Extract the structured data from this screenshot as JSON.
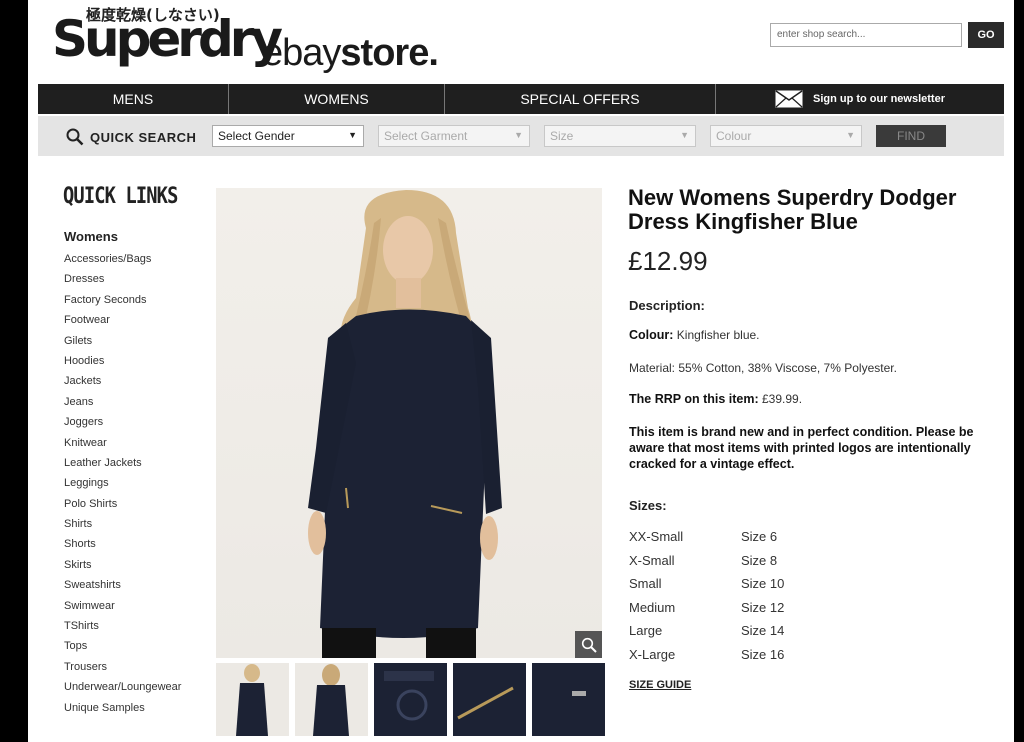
{
  "header": {
    "logo_jp": "極度乾燥(しなさい)",
    "logo_main": "Superdry",
    "logo_ebay_light": "ebay",
    "logo_ebay_bold": "store.",
    "search_placeholder": "enter shop search...",
    "go_label": "GO"
  },
  "nav": {
    "items": [
      "MENS",
      "WOMENS",
      "SPECIAL OFFERS"
    ],
    "newsletter": "Sign up to our newsletter"
  },
  "quick_search": {
    "label": "QUICK SEARCH",
    "gender": "Select Gender",
    "garment": "Select Garment",
    "size": "Size",
    "colour": "Colour",
    "find_label": "FIND"
  },
  "quick_links": {
    "title": "QUICK LINKS",
    "category": "Womens",
    "items": [
      "Accessories/Bags",
      "Dresses",
      "Factory Seconds",
      "Footwear",
      "Gilets",
      "Hoodies",
      "Jackets",
      "Jeans",
      "Joggers",
      "Knitwear",
      "Leather Jackets",
      "Leggings",
      "Polo Shirts",
      "Shirts",
      "Shorts",
      "Skirts",
      "Sweatshirts",
      "Swimwear",
      "TShirts",
      "Tops",
      "Trousers",
      "Underwear/Loungewear",
      "Unique Samples"
    ]
  },
  "product": {
    "title": "New Womens Superdry Dodger Dress Kingfisher Blue",
    "price": "£12.99",
    "description_label": "Description:",
    "colour_label": "Colour:",
    "colour_value": "Kingfisher blue.",
    "material": "Material: 55% Cotton, 38% Viscose, 7% Polyester.",
    "rrp_label": "The RRP on this item:",
    "rrp_value": "£39.99.",
    "note": "This item is brand new and in perfect condition. Please be aware that most items with printed logos are intentionally cracked for a vintage effect.",
    "sizes_label": "Sizes:",
    "sizes": [
      {
        "name": "XX-Small",
        "size": "Size 6"
      },
      {
        "name": "X-Small",
        "size": "Size 8"
      },
      {
        "name": "Small",
        "size": "Size 10"
      },
      {
        "name": "Medium",
        "size": "Size 12"
      },
      {
        "name": "Large",
        "size": "Size 14"
      },
      {
        "name": "X-Large",
        "size": "Size 16"
      }
    ],
    "size_guide": "SIZE GUIDE"
  },
  "colors": {
    "dress": "#1c2234",
    "nav_bg": "#1f1f1f",
    "bar_bg": "#e4e4e4"
  }
}
